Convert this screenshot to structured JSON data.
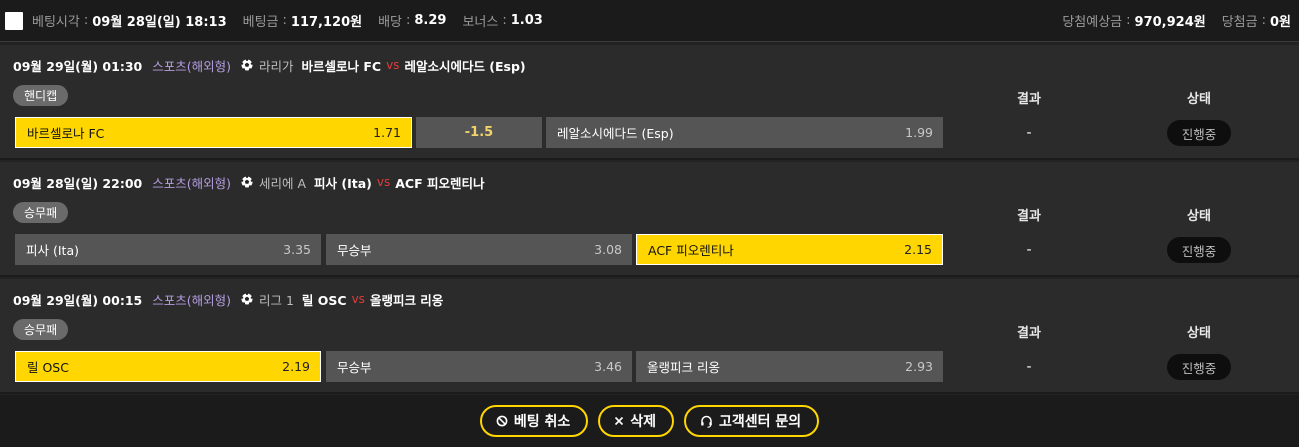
{
  "topbar": {
    "bet_time_label": "베팅시각",
    "bet_time_value": "09월 28일(일) 18:13",
    "bet_amount_label": "베팅금",
    "bet_amount_value": "117,120원",
    "odds_label": "배당",
    "odds_value": "8.29",
    "bonus_label": "보너스",
    "bonus_value": "1.03",
    "expected_win_label": "당첨예상금",
    "expected_win_value": "970,924원",
    "win_label": "당첨금",
    "win_value": "0원",
    "sep": ":"
  },
  "headers": {
    "result": "결과",
    "status": "상태"
  },
  "bets": [
    {
      "time": "09월 29일(월) 01:30",
      "category": "스포츠(해외형)",
      "league": "라리가",
      "home": "바르셀로나 FC",
      "vs": "vs",
      "away": "레알소시에다드 (Esp)",
      "type": "핸디캡",
      "options": [
        {
          "label": "바르셀로나 FC",
          "odds": "1.71"
        },
        {
          "label": "-1.5"
        },
        {
          "label": "레알소시에다드 (Esp)",
          "odds": "1.99"
        }
      ],
      "result": "-",
      "status": "진행중"
    },
    {
      "time": "09월 28일(일) 22:00",
      "category": "스포츠(해외형)",
      "league": "세리에 A",
      "home": "피사 (Ita)",
      "vs": "vs",
      "away": "ACF 피오렌티나",
      "type": "승무패",
      "options": [
        {
          "label": "피사 (Ita)",
          "odds": "3.35"
        },
        {
          "label": "무승부",
          "odds": "3.08"
        },
        {
          "label": "ACF 피오렌티나",
          "odds": "2.15"
        }
      ],
      "result": "-",
      "status": "진행중"
    },
    {
      "time": "09월 29일(월) 00:15",
      "category": "스포츠(해외형)",
      "league": "리그 1",
      "home": "릴 OSC",
      "vs": "vs",
      "away": "올랭피크 리옹",
      "type": "승무패",
      "options": [
        {
          "label": "릴 OSC",
          "odds": "2.19"
        },
        {
          "label": "무승부",
          "odds": "3.46"
        },
        {
          "label": "올랭피크 리옹",
          "odds": "2.93"
        }
      ],
      "result": "-",
      "status": "진행중"
    }
  ],
  "footer": {
    "cancel_label": "베팅 취소",
    "delete_label": "삭제",
    "support_label": "고객센터 문의"
  },
  "colors": {
    "accent": "#ffd600",
    "vs": "#e03c3c",
    "category": "#b59de0"
  }
}
